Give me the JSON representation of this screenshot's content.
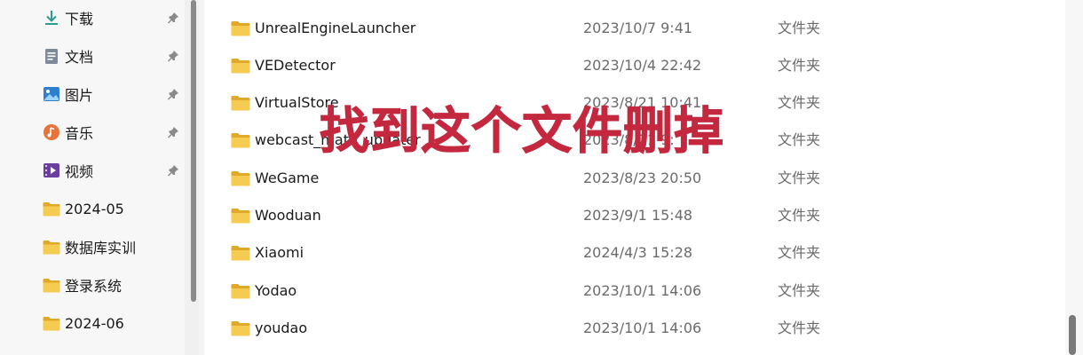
{
  "sidebar": {
    "items": [
      {
        "label": "下载",
        "icon": "download-icon",
        "pinned": true
      },
      {
        "label": "文档",
        "icon": "document-icon",
        "pinned": true
      },
      {
        "label": "图片",
        "icon": "picture-icon",
        "pinned": true
      },
      {
        "label": "音乐",
        "icon": "music-icon",
        "pinned": true
      },
      {
        "label": "视频",
        "icon": "video-icon",
        "pinned": true
      },
      {
        "label": "2024-05",
        "icon": "folder-icon",
        "pinned": false
      },
      {
        "label": "数据库实训",
        "icon": "folder-icon",
        "pinned": false
      },
      {
        "label": "登录系统",
        "icon": "folder-icon",
        "pinned": false
      },
      {
        "label": "2024-06",
        "icon": "folder-icon",
        "pinned": false
      }
    ]
  },
  "files": {
    "rows": [
      {
        "name": "UnrealEngineLauncher",
        "date": "2023/10/7 9:41",
        "type": "文件夹"
      },
      {
        "name": "VEDetector",
        "date": "2023/10/4 22:42",
        "type": "文件夹"
      },
      {
        "name": "VirtualStore",
        "date": "2023/8/21 10:41",
        "type": "文件夹"
      },
      {
        "name": "webcast_mate_updater",
        "date": "2023/8/21 9:",
        "type": "文件夹"
      },
      {
        "name": "WeGame",
        "date": "2023/8/23 20:50",
        "type": "文件夹"
      },
      {
        "name": "Wooduan",
        "date": "2023/9/1 15:48",
        "type": "文件夹"
      },
      {
        "name": "Xiaomi",
        "date": "2024/4/3 15:28",
        "type": "文件夹"
      },
      {
        "name": "Yodao",
        "date": "2023/10/1 14:06",
        "type": "文件夹"
      },
      {
        "name": "youdao",
        "date": "2023/10/1 14:06",
        "type": "文件夹"
      }
    ]
  },
  "annotation": {
    "text": "找到这个文件删掉",
    "color": "#c4283e"
  },
  "colors": {
    "folder": "#f4c84a",
    "folder_dark": "#e0a92a",
    "pin": "#8a8a8a"
  }
}
